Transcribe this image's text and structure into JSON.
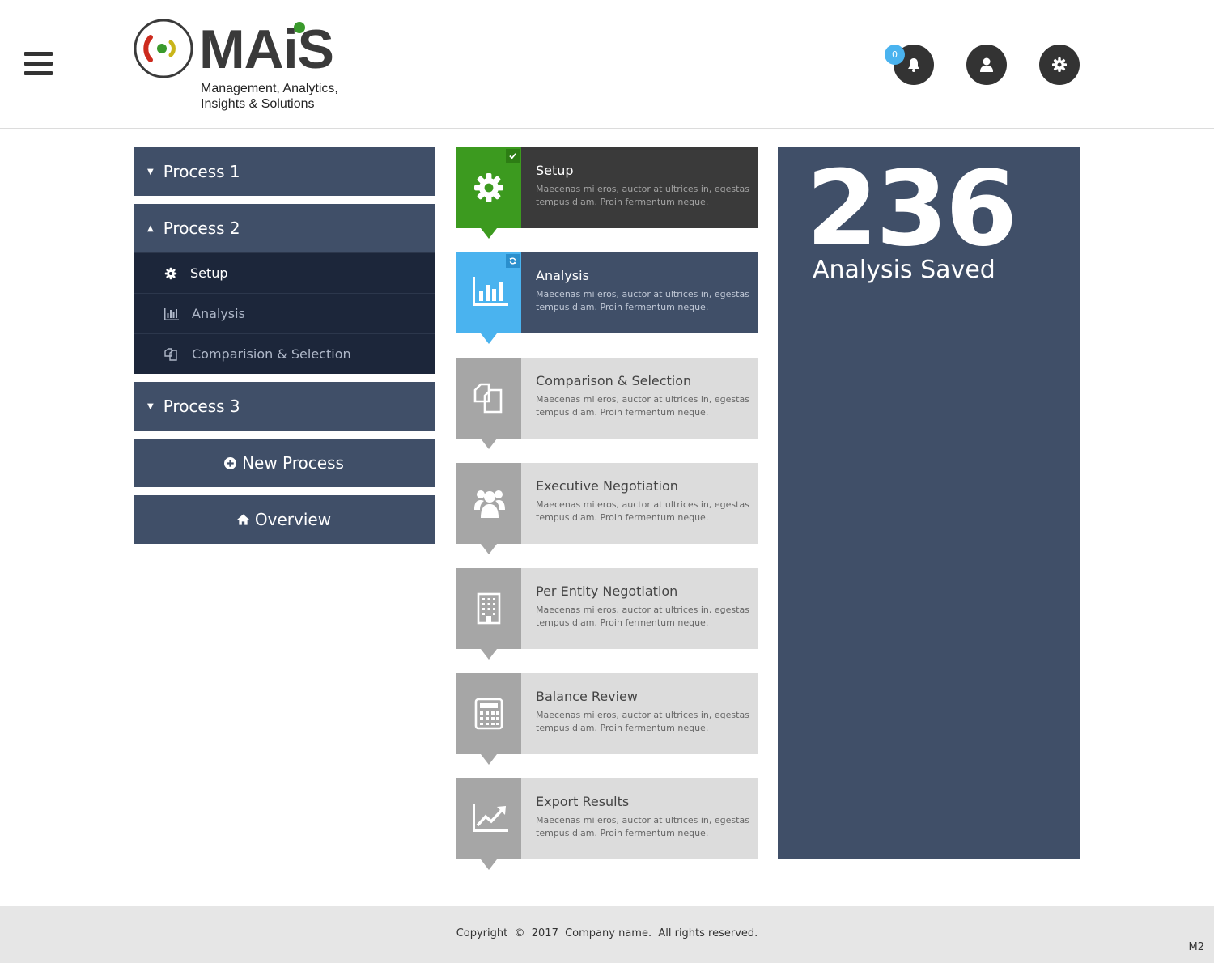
{
  "header": {
    "logo_word": "MAiS",
    "logo_tagline_1": "Management, Analytics,",
    "logo_tagline_2": "Insights & Solutions",
    "notification_count": "0",
    "icons": [
      "menu-icon",
      "bell-icon",
      "user-icon",
      "gear-icon"
    ]
  },
  "sidebar": {
    "process1": {
      "label": "Process 1",
      "state": "collapsed"
    },
    "process2": {
      "label": "Process 2",
      "state": "expanded",
      "items": [
        {
          "label": "Setup",
          "icon": "gear-icon",
          "active": true
        },
        {
          "label": "Analysis",
          "icon": "bar-chart-icon",
          "active": false
        },
        {
          "label": "Comparision & Selection",
          "icon": "copy-icon",
          "active": false
        }
      ]
    },
    "process3": {
      "label": "Process 3",
      "state": "collapsed"
    },
    "new_process_label": "New Process",
    "overview_label": "Overview"
  },
  "steps": [
    {
      "title": "Setup",
      "desc": "Maecenas mi eros, auctor at ultrices in, egestas tempus diam. Proin fermentum neque.",
      "icon": "gear-icon",
      "status": "completed",
      "status_icon": "check-icon",
      "icon_color": "#3c9a1f",
      "body_color": "#3a3a3a"
    },
    {
      "title": "Analysis",
      "desc": "Maecenas mi eros, auctor at ultrices in, egestas tempus diam. Proin fermentum neque.",
      "icon": "bar-chart-icon",
      "status": "in-progress",
      "status_icon": "refresh-icon",
      "icon_color": "#4ab3ef",
      "body_color": "#404f68"
    },
    {
      "title": "Comparison & Selection",
      "desc": "Maecenas mi eros, auctor at ultrices in, egestas tempus diam. Proin fermentum neque.",
      "icon": "copy-icon",
      "status": "pending",
      "icon_color": "#a6a6a6",
      "body_color": "#dcdcdc"
    },
    {
      "title": "Executive Negotiation",
      "desc": "Maecenas mi eros, auctor at ultrices in, egestas tempus diam. Proin fermentum neque.",
      "icon": "users-icon",
      "status": "pending",
      "icon_color": "#a6a6a6",
      "body_color": "#dcdcdc"
    },
    {
      "title": "Per Entity Negotiation",
      "desc": "Maecenas mi eros, auctor at ultrices in, egestas tempus diam. Proin fermentum neque.",
      "icon": "building-icon",
      "status": "pending",
      "icon_color": "#a6a6a6",
      "body_color": "#dcdcdc"
    },
    {
      "title": "Balance Review",
      "desc": "Maecenas mi eros, auctor at ultrices in, egestas tempus diam. Proin fermentum neque.",
      "icon": "calculator-icon",
      "status": "pending",
      "icon_color": "#a6a6a6",
      "body_color": "#dcdcdc"
    },
    {
      "title": "Export Results",
      "desc": "Maecenas mi eros, auctor at ultrices in, egestas tempus diam. Proin fermentum neque.",
      "icon": "line-chart-icon",
      "status": "pending",
      "icon_color": "#a6a6a6",
      "body_color": "#dcdcdc"
    }
  ],
  "stats": {
    "value": "236",
    "label": "Analysis Saved"
  },
  "footer": {
    "copyright": "Copyright  ©  2017  Company name.  All rights reserved.",
    "version": "M2"
  },
  "colors": {
    "navy": "#404f68",
    "navy_dark": "#1c263a",
    "green": "#3c9a1f",
    "blue": "#4ab3ef",
    "grey_icon": "#a6a6a6",
    "grey_body": "#dcdcdc",
    "header_button": "#333333"
  }
}
